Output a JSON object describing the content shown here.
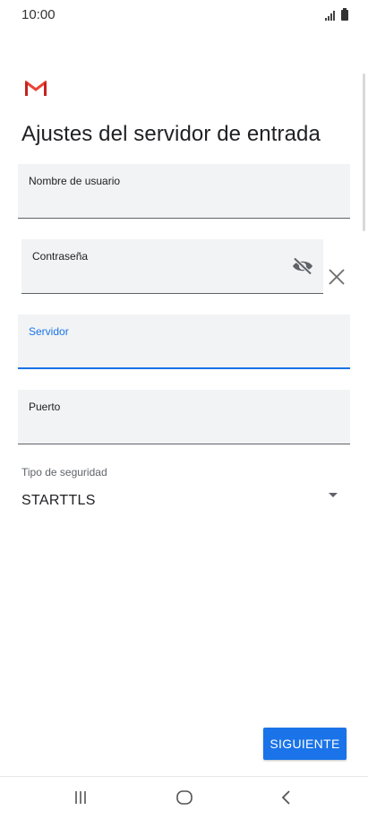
{
  "status_bar": {
    "time": "10:00"
  },
  "app": {
    "logo_icon": "gmail-m-icon",
    "brand_colors": [
      "#ea4335",
      "#c5221f"
    ]
  },
  "page": {
    "title": "Ajustes del servidor de entrada"
  },
  "form": {
    "username": {
      "label": "Nombre de usuario",
      "value": ""
    },
    "password": {
      "label": "Contraseña",
      "value": "",
      "toggle_icon": "visibility-off-icon",
      "clear_icon": "close-icon"
    },
    "server": {
      "label": "Servidor",
      "value": "",
      "focused": true
    },
    "port": {
      "label": "Puerto",
      "value": ""
    },
    "security": {
      "label": "Tipo de seguridad",
      "value": "STARTTLS",
      "icon": "dropdown-arrow-icon"
    }
  },
  "actions": {
    "next_label": "SIGUIENTE"
  },
  "nav_bar": {
    "recents_icon": "recent-apps-icon",
    "home_icon": "home-icon",
    "back_icon": "back-icon"
  },
  "colors": {
    "accent": "#1a73e8",
    "field_bg": "#f1f3f4",
    "text": "#202124"
  }
}
